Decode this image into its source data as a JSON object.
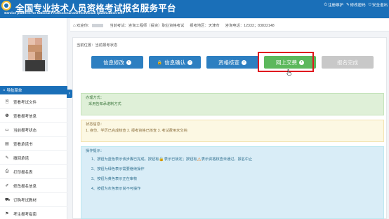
{
  "header": {
    "title": "全国专业技术人员资格考试报名服务平台",
    "subtitle": "Service platform for National Professional and technician qualification test",
    "links": [
      {
        "icon": "power-icon",
        "label": "注册维护"
      },
      {
        "icon": "edit-icon",
        "label": "修改密码"
      },
      {
        "icon": "logout-icon",
        "label": "安全退出"
      }
    ]
  },
  "infobar": {
    "welcome": "欢迎你：",
    "exam": "当前考试：咨询工程师（投资）职业资格考试",
    "area": "报考地区：天津市",
    "phone": "咨询电话：12333；83832148"
  },
  "sidebar": {
    "menu_title": "导航菜单",
    "items": [
      {
        "icon": "file-icon",
        "label": "查看考试文件"
      },
      {
        "icon": "info-icon",
        "label": "查看报考信息"
      },
      {
        "icon": "monitor-icon",
        "label": "当前报考状态"
      },
      {
        "icon": "book-icon",
        "label": "查看承诺书"
      },
      {
        "icon": "pencil-icon",
        "label": "撤回承诺"
      },
      {
        "icon": "print-icon",
        "label": "打印报名表"
      },
      {
        "icon": "edit-icon",
        "label": "修改报名信息"
      },
      {
        "icon": "cart-icon",
        "label": "订购考试教材"
      },
      {
        "icon": "flag-icon",
        "label": "考生报考指南"
      }
    ]
  },
  "main": {
    "breadcrumb": "当前位置：当前报考状态",
    "steps": [
      {
        "label": "信息修改",
        "state": "done"
      },
      {
        "label": "信息确认",
        "state": "locked"
      },
      {
        "label": "资格核查",
        "state": "done"
      },
      {
        "label": "网上交费",
        "state": "current"
      },
      {
        "label": "报名完成",
        "state": "disabled"
      }
    ],
    "method": {
      "title": "办理方式：",
      "text": "采用告知承诺制方式"
    },
    "status": {
      "title": "状态信息：",
      "text": "1. 身份、学历已完成核查 2. 报考资格已核查 3. 考试费用未交纳"
    },
    "tips": {
      "title": "操作提示：",
      "rows": [
        {
          "pre": "1、按钮为蓝色表示该步骤已完成。按钮有",
          "mid": "表示已锁定；按钮有",
          "post": "表示资格核查未通过，报名中止"
        },
        {
          "text": "2、按钮为绿色表示需要继续操作"
        },
        {
          "text": "3、按钮为黄色表示正在审核"
        },
        {
          "text": "4、按钮为灰色表示尚不可操作"
        }
      ]
    }
  },
  "colors": {
    "brand_blue": "#1a6fb8",
    "step_done": "#2d7fc1",
    "step_current": "#5cb85c",
    "step_disabled": "#c8c8c8",
    "highlight_red": "#e0181e"
  }
}
